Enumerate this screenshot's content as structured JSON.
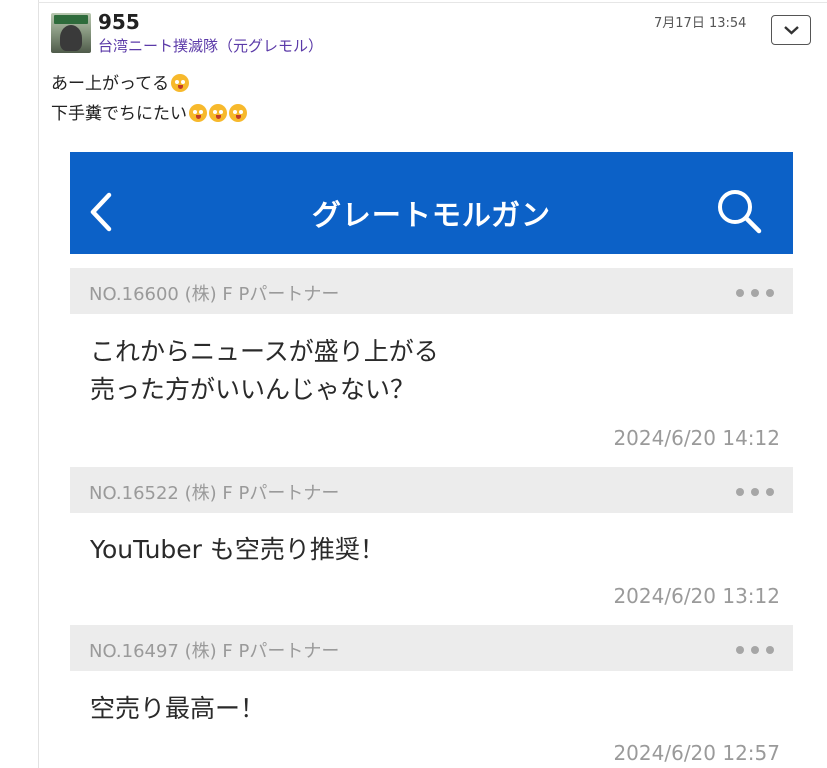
{
  "post": {
    "number": "955",
    "username": "台湾ニート撲滅隊（元グレモル）",
    "date": "7月17日 13:54",
    "lines": [
      "あー上がってる",
      "下手糞でちにたい"
    ]
  },
  "embed": {
    "header_title": "グレートモルガン",
    "messages": [
      {
        "no": "NO.16600",
        "author": "(株) F Pパートナー",
        "body": [
          "これからニュースが盛り上がる",
          "売った方がいいんじゃない？"
        ],
        "time": "2024/6/20 14:12"
      },
      {
        "no": "NO.16522",
        "author": "(株) F Pパートナー",
        "body": [
          "YouTuber も空売り推奨！"
        ],
        "time": "2024/6/20 13:12"
      },
      {
        "no": "NO.16497",
        "author": "(株) F Pパートナー",
        "body": [
          "空売り最高ー！"
        ],
        "time": "2024/6/20 12:57"
      }
    ]
  },
  "icons": {
    "menu": "chevron-down-icon",
    "back": "back-arrow-icon",
    "search": "search-icon",
    "more": "more-dots-icon",
    "emoji": "drooling-face-emoji"
  },
  "colors": {
    "header_blue": "#0c61c7",
    "username_purple": "#5b3aa8",
    "meta_bar": "#ececec"
  }
}
